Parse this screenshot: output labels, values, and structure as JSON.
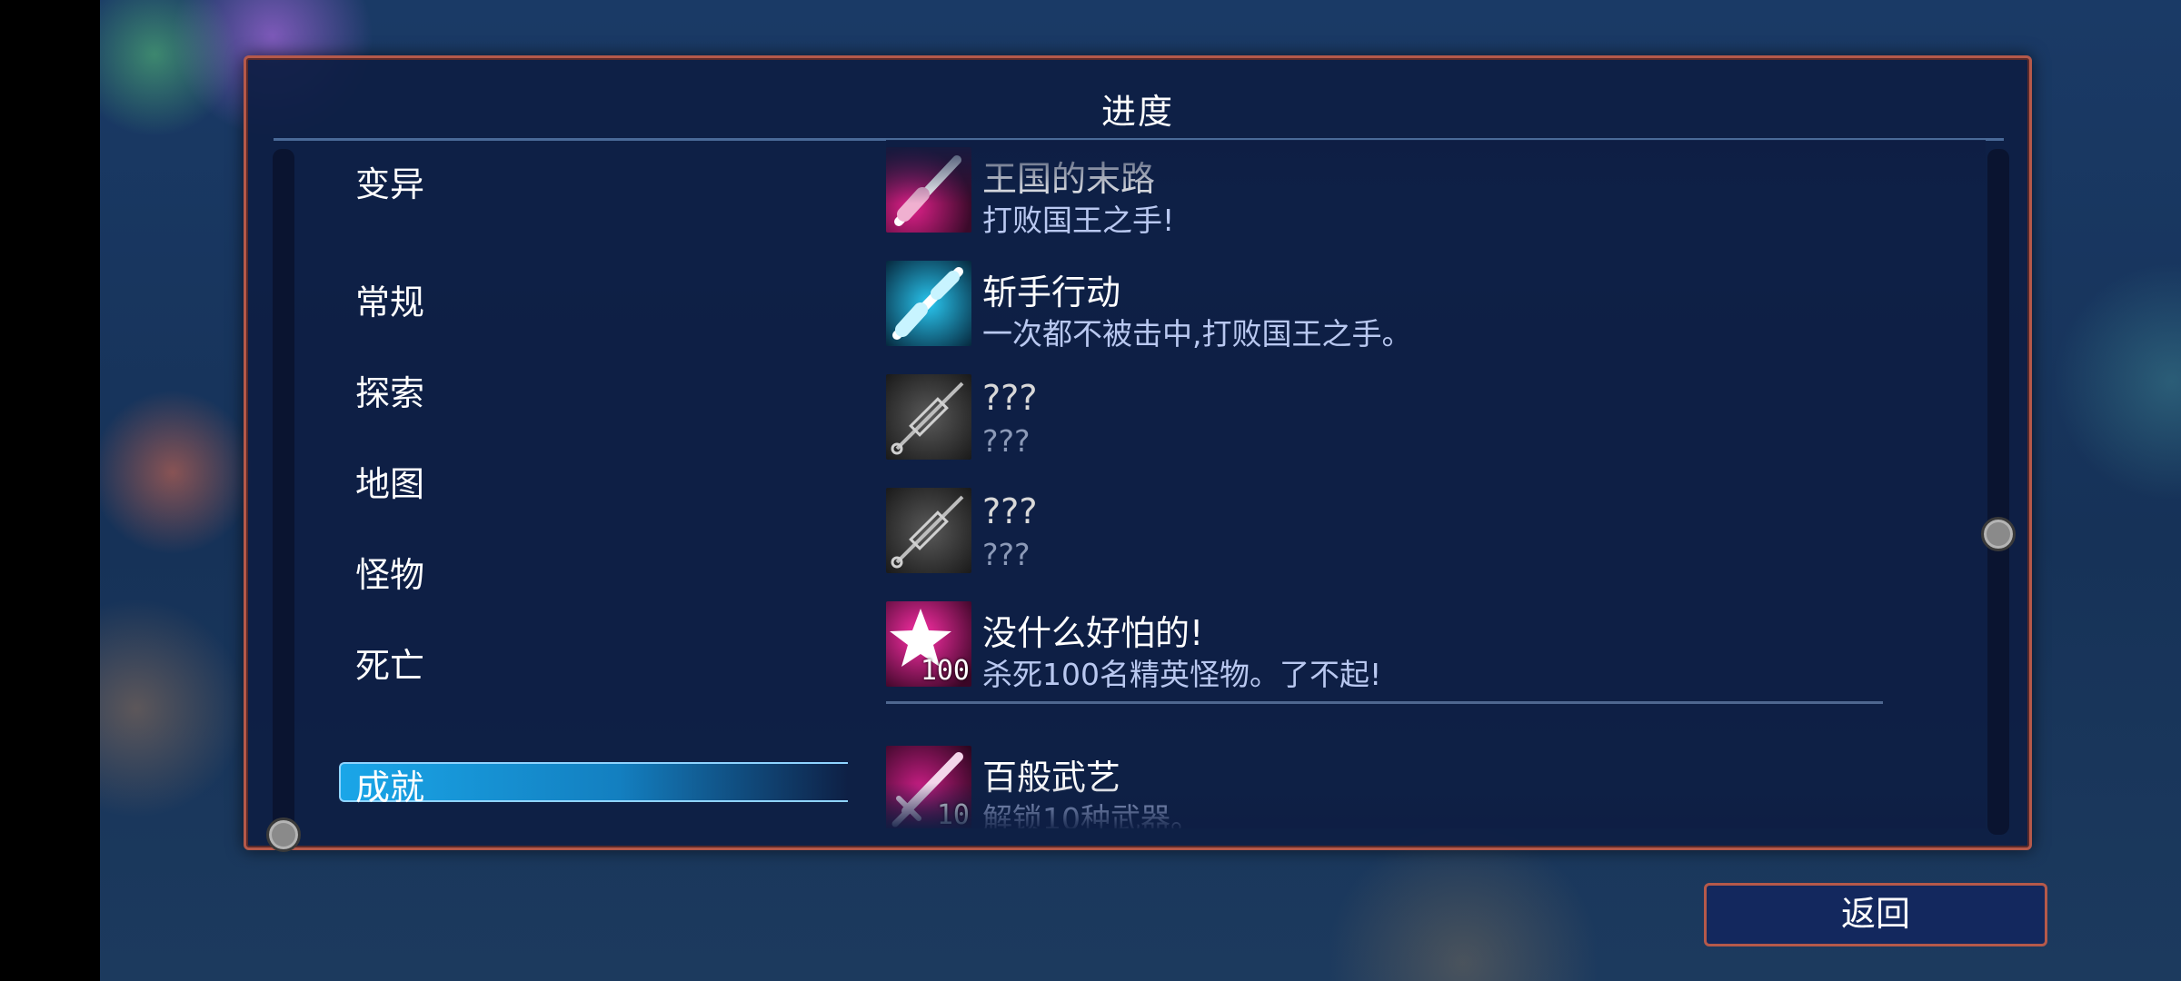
{
  "screen": {
    "title": "进度",
    "back_label": "返回"
  },
  "sidebar": {
    "items": [
      {
        "label": "变异",
        "selected": false
      },
      {
        "label": "常规",
        "selected": false
      },
      {
        "label": "探索",
        "selected": false
      },
      {
        "label": "地图",
        "selected": false
      },
      {
        "label": "怪物",
        "selected": false
      },
      {
        "label": "死亡",
        "selected": false
      },
      {
        "label": "成就",
        "selected": true
      }
    ]
  },
  "achievements": [
    {
      "name": "王国的末路",
      "desc": "打败国王之手!",
      "icon": "pink-syringe-icon",
      "badge": ""
    },
    {
      "name": "斩手行动",
      "desc": "一次都不被击中,打败国王之手。",
      "icon": "cyan-syringe-icon",
      "badge": ""
    },
    {
      "name": "???",
      "desc": "???",
      "icon": "locked-syringe-icon",
      "badge": ""
    },
    {
      "name": "???",
      "desc": "???",
      "icon": "locked-syringe-icon",
      "badge": ""
    },
    {
      "name": "没什么好怕的!",
      "desc": "杀死100名精英怪物。了不起!",
      "icon": "star-icon",
      "badge": "100"
    },
    {
      "name": "百般武艺",
      "desc": "解锁10种武器。",
      "icon": "sword-icon",
      "badge": "10"
    }
  ],
  "colors": {
    "panel_border": "#b5594a",
    "selected_tab": "#1aa6e8",
    "desc_text": "#b9c8f0"
  }
}
